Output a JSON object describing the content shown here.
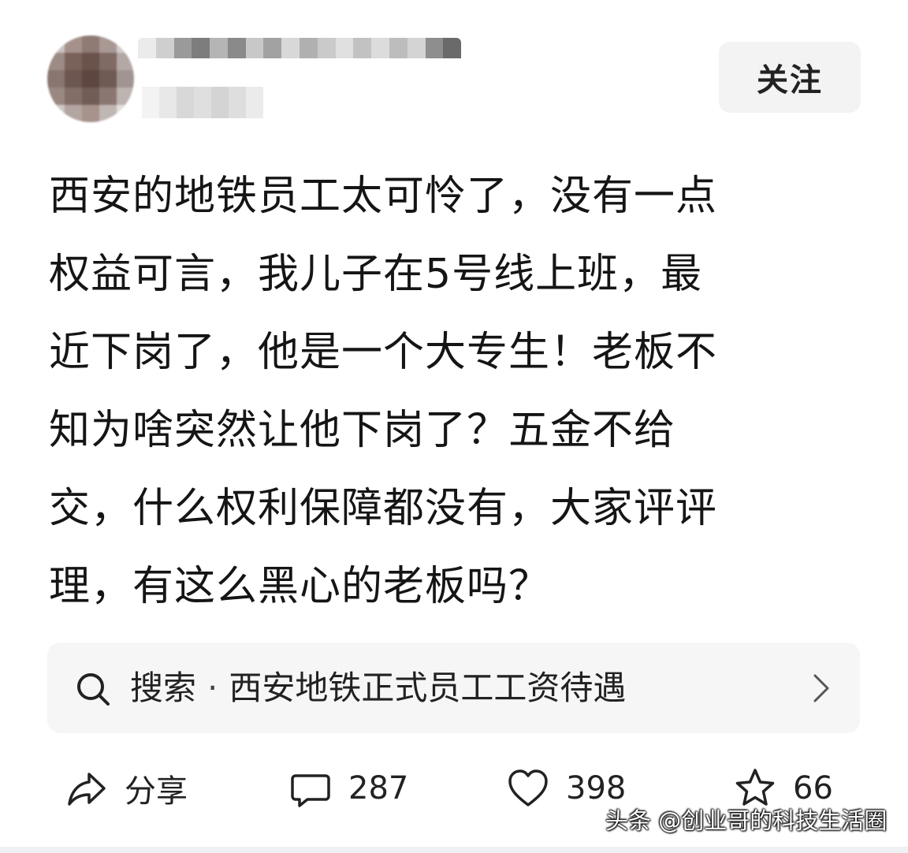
{
  "header": {
    "follow_label": "关注"
  },
  "post": {
    "lines": [
      "西安的地铁员工太可怜了，没有一点",
      "权益可言，我儿子在5号线上班，最",
      "近下岗了，他是一个大专生！老板不",
      "知为啥突然让他下岗了？五金不给",
      "交，什么权利保障都没有，大家评评",
      "理，有这么黑心的老板吗？"
    ]
  },
  "search": {
    "prefix": "搜索",
    "separator": "·",
    "query": "西安地铁正式员工工资待遇",
    "icon": "search-icon",
    "chevron": "chevron-right-icon"
  },
  "actions": {
    "share_label": "分享",
    "comment_count": "287",
    "like_count": "398",
    "favorite_count": "66"
  },
  "watermark": {
    "text": "头条 @创业哥的科技生活圈"
  },
  "colors": {
    "follow_bg": "#f3f3f3",
    "search_bg": "#f6f6f7",
    "text": "#151515"
  }
}
